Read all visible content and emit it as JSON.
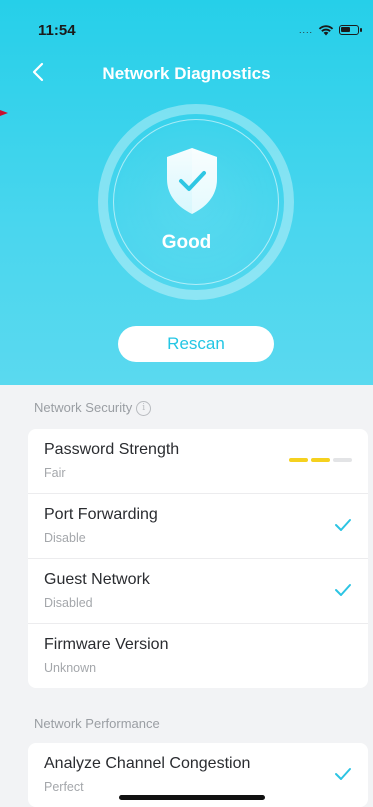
{
  "status_bar": {
    "time": "11:54",
    "signal": "....",
    "wifi_icon": "wifi-icon",
    "battery_icon": "battery-icon"
  },
  "header": {
    "title": "Network Diagnostics",
    "back_icon": "chevron-left-icon"
  },
  "diagnosis": {
    "status": "Good",
    "icon": "shield-check-icon"
  },
  "rescan_label": "Rescan",
  "colors": {
    "accent": "#26cfe9",
    "strength_filled": "#f5d11f",
    "strength_empty": "#e3e4e6",
    "check": "#2cc4e3"
  },
  "security": {
    "heading": "Network Security",
    "items": [
      {
        "title": "Password Strength",
        "subtitle": "Fair",
        "indicator": "strength-bar",
        "strength_level": 2,
        "strength_max": 3
      },
      {
        "title": "Port Forwarding",
        "subtitle": "Disable",
        "indicator": "check-icon"
      },
      {
        "title": "Guest Network",
        "subtitle": "Disabled",
        "indicator": "check-icon"
      },
      {
        "title": "Firmware Version",
        "subtitle": "Unknown",
        "indicator": ""
      }
    ]
  },
  "performance": {
    "heading": "Network Performance",
    "items": [
      {
        "title": "Analyze Channel Congestion",
        "subtitle": "Perfect",
        "indicator": "check-icon"
      }
    ]
  }
}
